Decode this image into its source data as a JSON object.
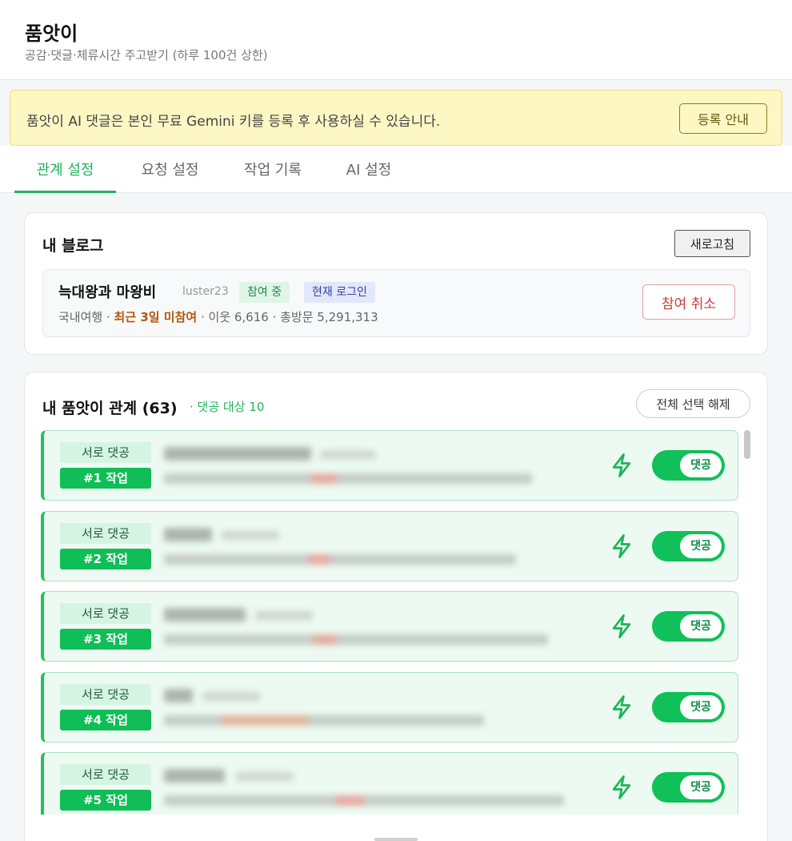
{
  "app": {
    "title": "품앗이",
    "subtitle": "공감·댓글·체류시간 주고받기 (하루 100건 상한)"
  },
  "banner": {
    "text": "품앗이 AI 댓글은 본인 무료 Gemini 키를 등록 후 사용하실 수 있습니다.",
    "button": "등록 안내"
  },
  "tabs": [
    {
      "label": "관계 설정",
      "active": true
    },
    {
      "label": "요청 설정",
      "active": false
    },
    {
      "label": "작업 기록",
      "active": false
    },
    {
      "label": "AI 설정",
      "active": false
    }
  ],
  "my_blog": {
    "title": "내 블로그",
    "refresh_button": "새로고침",
    "name": "늑대왕과 마왕비",
    "id": "luster23",
    "badge_joined": "참여 중",
    "badge_login": "현재 로그인",
    "meta_category": "국내여행 · ",
    "meta_warning": "최근 3일 미참여",
    "meta_stats": " · 이웃 6,616 · 총방문 5,291,313",
    "cancel_button": "참여 취소"
  },
  "relations": {
    "title": "내 품앗이 관계",
    "count": "(63)",
    "target_text": "· 댓공 대상 10",
    "deselect_button": "전체 선택 해제",
    "rows": [
      {
        "tag": "서로 댓공",
        "job": "#1 작업",
        "toggle": "댓공"
      },
      {
        "tag": "서로 댓공",
        "job": "#2 작업",
        "toggle": "댓공"
      },
      {
        "tag": "서로 댓공",
        "job": "#3 작업",
        "toggle": "댓공"
      },
      {
        "tag": "서로 댓공",
        "job": "#4 작업",
        "toggle": "댓공"
      },
      {
        "tag": "서로 댓공",
        "job": "#5 작업",
        "toggle": "댓공"
      }
    ]
  },
  "colors": {
    "accent_green": "#22b35e",
    "toggle_green": "#10c059",
    "warning_orange": "#b5560a",
    "cancel_red": "#cf3a3a"
  },
  "icons": {
    "row_action": "lightning-bolt-icon"
  }
}
